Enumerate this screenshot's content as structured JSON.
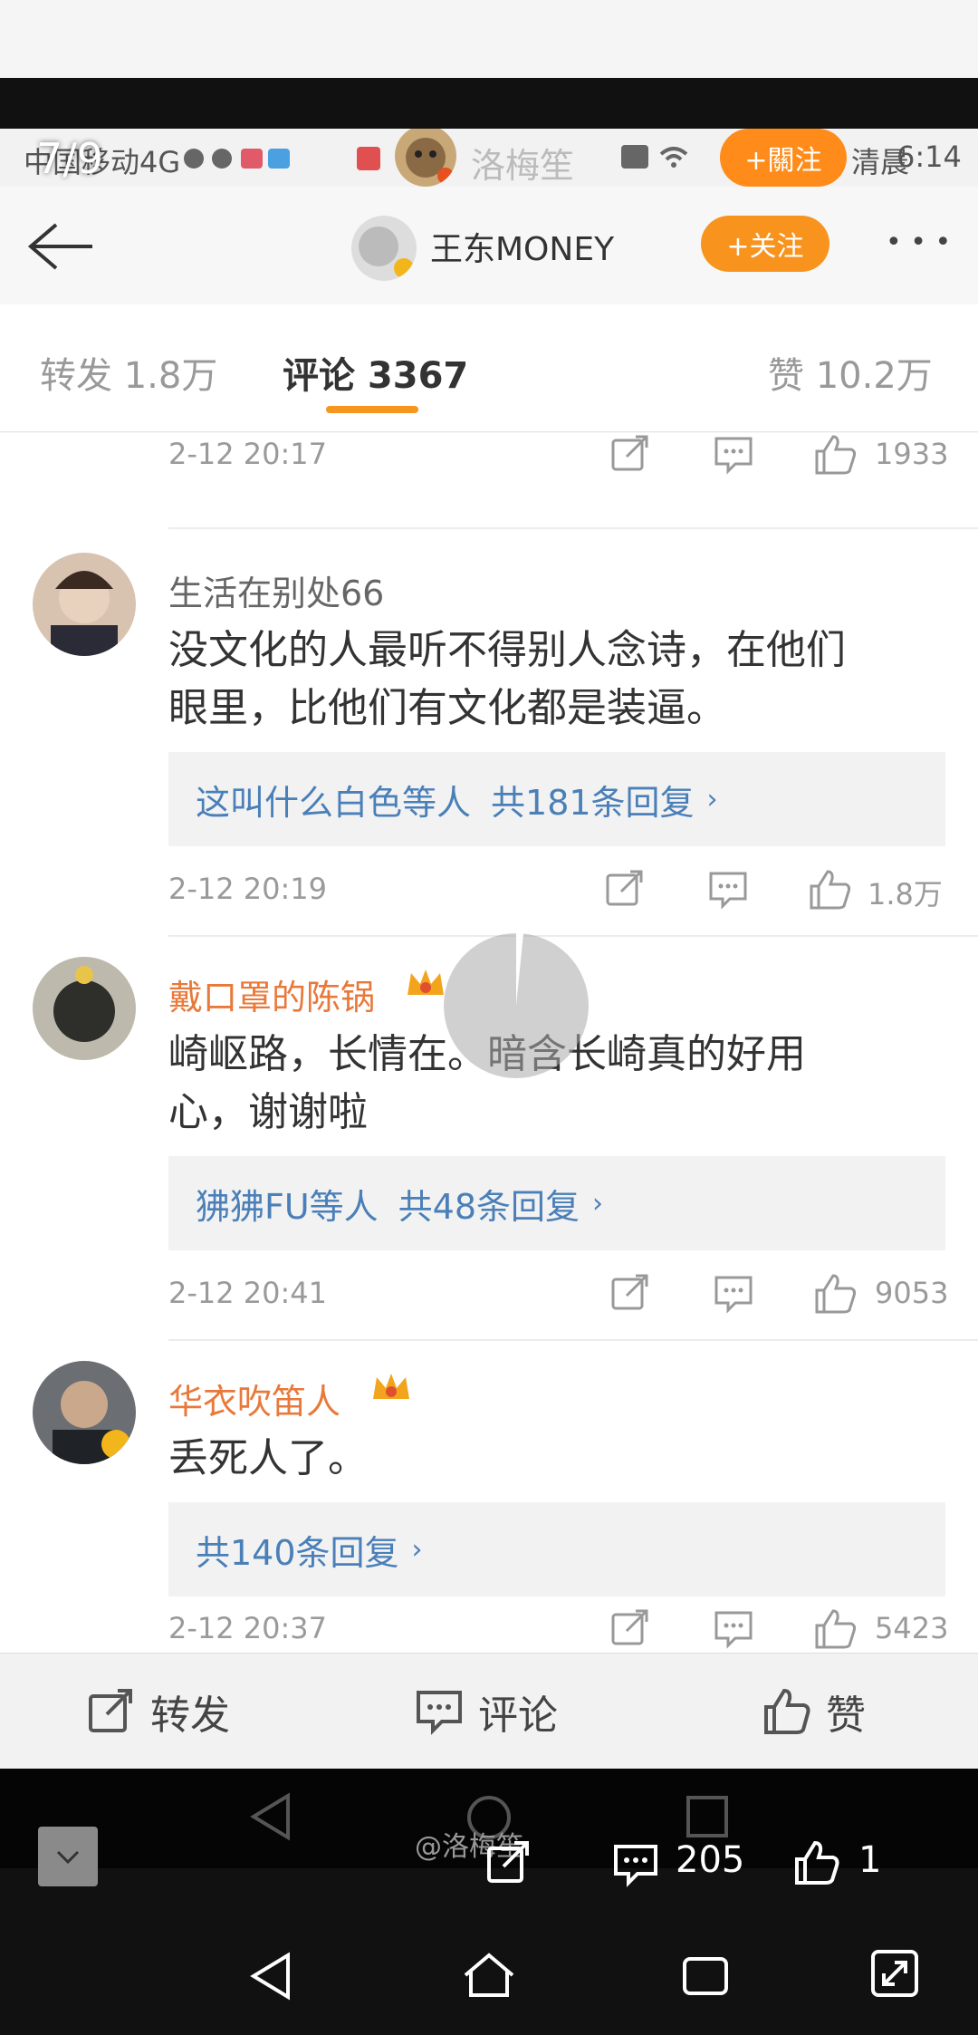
{
  "overlay": {
    "page_indicator": "7/9",
    "uploader_name": "洛梅笙",
    "follow_label": "+關注",
    "carrier": "中国移动4G",
    "time": "6:14",
    "time_prefix": "清晨"
  },
  "nav": {
    "title": "王东MONEY",
    "follow_label": "+关注",
    "more_label": "• • •"
  },
  "tabs": [
    {
      "label": "转发 1.8万"
    },
    {
      "label": "评论 3367"
    },
    {
      "label": "赞 10.2万"
    }
  ],
  "comments": [
    {
      "time": "2-12 20:17",
      "likes": "1933"
    },
    {
      "user": "生活在别处66",
      "user_color": "#666666",
      "text_line1": "没文化的人最听不得别人念诗，在他们",
      "text_line2": "眼里，比他们有文化都是装逼。",
      "reply_users": "这叫什么白色等人",
      "reply_count": "共181条回复",
      "time": "2-12 20:19",
      "likes": "1.8万"
    },
    {
      "user": "戴口罩的陈锅",
      "user_color": "#e8793a",
      "text_line1": "崎岖路，长情在。暗含长崎真的好用",
      "text_line2": "心，谢谢啦",
      "reply_users": "狒狒FU等人",
      "reply_count": "共48条回复",
      "time": "2-12 20:41",
      "likes": "9053"
    },
    {
      "user": "华衣吹笛人",
      "user_color": "#e8793a",
      "text_line1": "丢死人了。",
      "reply_count": "共140条回复",
      "time": "2-12 20:37",
      "likes": "5423"
    }
  ],
  "actionbar": {
    "repost": "转发",
    "comment": "评论",
    "like": "赞"
  },
  "video_bar": {
    "watermark": "@洛梅笙",
    "comment_count": "205",
    "like_count": "1"
  },
  "colors": {
    "accent": "#f8941e",
    "link": "#4a7fb8"
  }
}
